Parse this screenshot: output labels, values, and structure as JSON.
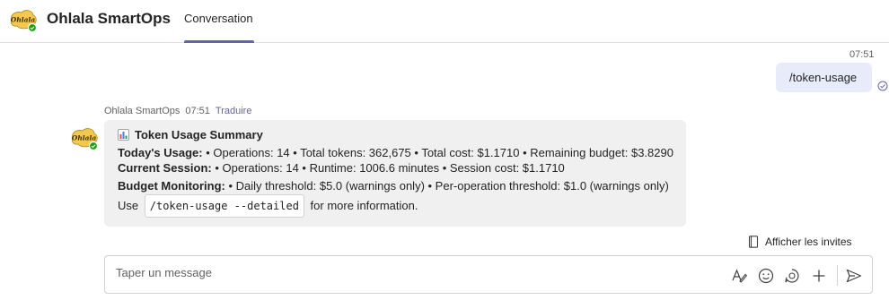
{
  "header": {
    "app_title": "Ohlala SmartOps",
    "tab_label": "Conversation",
    "logo_text": "Ohlala"
  },
  "user_message": {
    "time": "07:51",
    "text": "/token-usage"
  },
  "bot_message": {
    "sender": "Ohlala SmartOps",
    "time": "07:51",
    "translate_label": "Traduire",
    "title": "Token Usage Summary",
    "lines": [
      {
        "label": "Today's Usage:",
        "text": " • Operations: 14 • Total tokens: 362,675 • Total cost: $1.1710 • Remaining budget: $3.8290"
      },
      {
        "label": "Current Session:",
        "text": " • Operations: 14 • Runtime: 1006.6 minutes • Session cost: $1.1710"
      },
      {
        "label": "Budget Monitoring:",
        "text": " • Daily threshold: $5.0 (warnings only) • Per-operation threshold: $1.0 (warnings only)"
      }
    ],
    "use_prefix": "Use",
    "command": "/token-usage --detailed",
    "use_suffix": "for more information."
  },
  "invites_label": "Afficher les invites",
  "composer": {
    "placeholder": "Taper un message"
  },
  "icons": {
    "logo": "ohlala-logo-icon",
    "read": "read-receipt-icon",
    "chart": "bar-chart-icon",
    "invites": "notebook-icon",
    "format": "format-icon",
    "emoji": "emoji-icon",
    "loop": "loop-icon",
    "plus": "plus-icon",
    "send": "send-icon"
  },
  "colors": {
    "accent": "#6264a7",
    "user_bubble": "#e8ebfa",
    "bot_card": "#f0f0f0",
    "status_green": "#13a10e",
    "logo_yellow": "#f2c94c"
  }
}
